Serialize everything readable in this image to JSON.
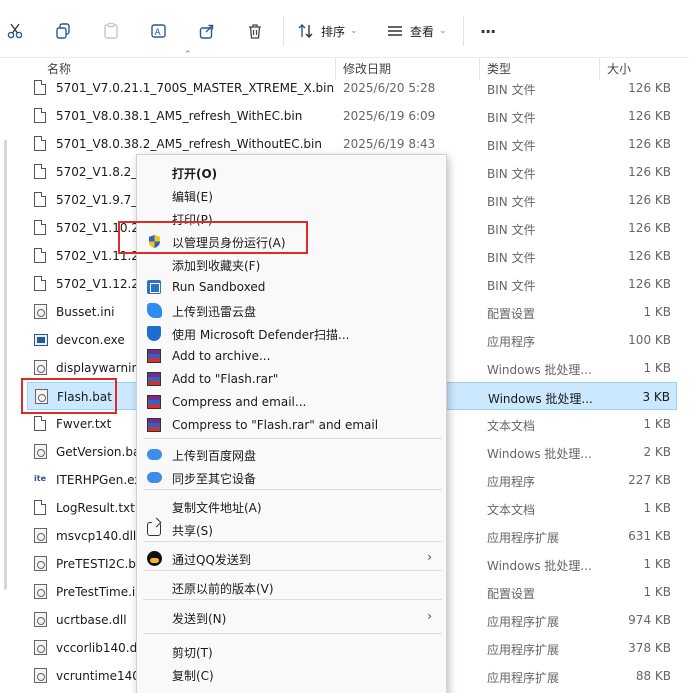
{
  "toolbar": {
    "sort_label": "排序",
    "view_label": "查看",
    "more": "···"
  },
  "columns": {
    "name": "名称",
    "date": "修改日期",
    "type": "类型",
    "size": "大小"
  },
  "files": [
    {
      "name": "5701_V7.0.21.1_700S_MASTER_XTREME_X.bin",
      "date": "2025/6/20 5:28",
      "type": "BIN 文件",
      "size": "126 KB",
      "icon": "file-icon"
    },
    {
      "name": "5701_V8.0.38.1_AM5_refresh_WithEC.bin",
      "date": "2025/6/19 6:09",
      "type": "BIN 文件",
      "size": "126 KB",
      "icon": "file-icon"
    },
    {
      "name": "5701_V8.0.38.2_AM5_refresh_WithoutEC.bin",
      "date": "2025/6/19 8:43",
      "type": "BIN 文件",
      "size": "126 KB",
      "icon": "file-icon"
    },
    {
      "name": "5702_V1.8.2_A",
      "date": "",
      "type": "BIN 文件",
      "size": "126 KB",
      "icon": "file-icon"
    },
    {
      "name": "5702_V1.9.7_7",
      "date": "",
      "type": "BIN 文件",
      "size": "126 KB",
      "icon": "file-icon"
    },
    {
      "name": "5702_V1.10.2_",
      "date": "",
      "type": "BIN 文件",
      "size": "126 KB",
      "icon": "file-icon"
    },
    {
      "name": "5702_V1.11.2_",
      "date": "",
      "type": "BIN 文件",
      "size": "126 KB",
      "icon": "file-icon"
    },
    {
      "name": "5702_V1.12.2_",
      "date": "",
      "type": "BIN 文件",
      "size": "126 KB",
      "icon": "file-icon"
    },
    {
      "name": "Busset.ini",
      "date": "",
      "type": "配置设置",
      "size": "1 KB",
      "icon": "settings-file-icon"
    },
    {
      "name": "devcon.exe",
      "date": "",
      "type": "应用程序",
      "size": "100 KB",
      "icon": "exe-icon"
    },
    {
      "name": "displaywarnin",
      "date": "",
      "type": "Windows 批处理...",
      "size": "1 KB",
      "icon": "batch-file-icon"
    },
    {
      "name": "Flash.bat",
      "date": "",
      "type": "Windows 批处理...",
      "size": "3 KB",
      "icon": "batch-file-icon"
    },
    {
      "name": "Fwver.txt",
      "date": "",
      "type": "文本文档",
      "size": "1 KB",
      "icon": "text-file-icon"
    },
    {
      "name": "GetVersion.ba",
      "date": "",
      "type": "Windows 批处理...",
      "size": "2 KB",
      "icon": "batch-file-icon"
    },
    {
      "name": "ITERHPGen.ex",
      "date": "",
      "type": "应用程序",
      "size": "227 KB",
      "icon": "ite-exe-icon"
    },
    {
      "name": "LogResult.txt",
      "date": "",
      "type": "文本文档",
      "size": "1 KB",
      "icon": "text-file-icon"
    },
    {
      "name": "msvcp140.dll",
      "date": "",
      "type": "应用程序扩展",
      "size": "631 KB",
      "icon": "dll-file-icon"
    },
    {
      "name": "PreTESTI2C.ba",
      "date": "",
      "type": "Windows 批处理...",
      "size": "1 KB",
      "icon": "batch-file-icon"
    },
    {
      "name": "PreTestTime.ir",
      "date": "",
      "type": "配置设置",
      "size": "1 KB",
      "icon": "settings-file-icon"
    },
    {
      "name": "ucrtbase.dll",
      "date": "",
      "type": "应用程序扩展",
      "size": "974 KB",
      "icon": "dll-file-icon"
    },
    {
      "name": "vccorlib140.dl",
      "date": "",
      "type": "应用程序扩展",
      "size": "378 KB",
      "icon": "dll-file-icon"
    },
    {
      "name": "vcruntime140.",
      "date": "",
      "type": "应用程序扩展",
      "size": "88 KB",
      "icon": "dll-file-icon"
    }
  ],
  "context_menu": {
    "items": [
      {
        "label": "打开(O)",
        "icon": ""
      },
      {
        "label": "编辑(E)",
        "icon": ""
      },
      {
        "label": "打印(P)",
        "icon": ""
      },
      {
        "label": "以管理员身份运行(A)",
        "icon": "uac-shield-icon"
      },
      {
        "label": "添加到收藏夹(F)",
        "icon": ""
      },
      {
        "label": "Run Sandboxed",
        "icon": "sandbox-icon"
      },
      {
        "label": "上传到迅雷云盘",
        "icon": "xunlei-icon"
      },
      {
        "label": "使用 Microsoft Defender扫描...",
        "icon": "defender-shield-icon"
      },
      {
        "label": "Add to archive...",
        "icon": "winrar-icon"
      },
      {
        "label": "Add to \"Flash.rar\"",
        "icon": "winrar-icon"
      },
      {
        "label": "Compress and email...",
        "icon": "winrar-icon"
      },
      {
        "label": "Compress to \"Flash.rar\" and email",
        "icon": "winrar-icon"
      },
      {
        "label": "上传到百度网盘",
        "icon": "baidu-cloud-icon"
      },
      {
        "label": "同步至其它设备",
        "icon": "baidu-sync-icon"
      },
      {
        "label": "复制文件地址(A)",
        "icon": ""
      },
      {
        "label": "共享(S)",
        "icon": "share-icon"
      },
      {
        "label": "通过QQ发送到",
        "icon": "qq-icon",
        "submenu": "›"
      },
      {
        "label": "还原以前的版本(V)",
        "icon": ""
      },
      {
        "label": "发送到(N)",
        "icon": "",
        "submenu": "›"
      },
      {
        "label": "剪切(T)",
        "icon": ""
      },
      {
        "label": "复制(C)",
        "icon": ""
      }
    ]
  },
  "colors": {
    "selection_bg": "#cce8ff",
    "highlight_red": "#e02b2b"
  }
}
